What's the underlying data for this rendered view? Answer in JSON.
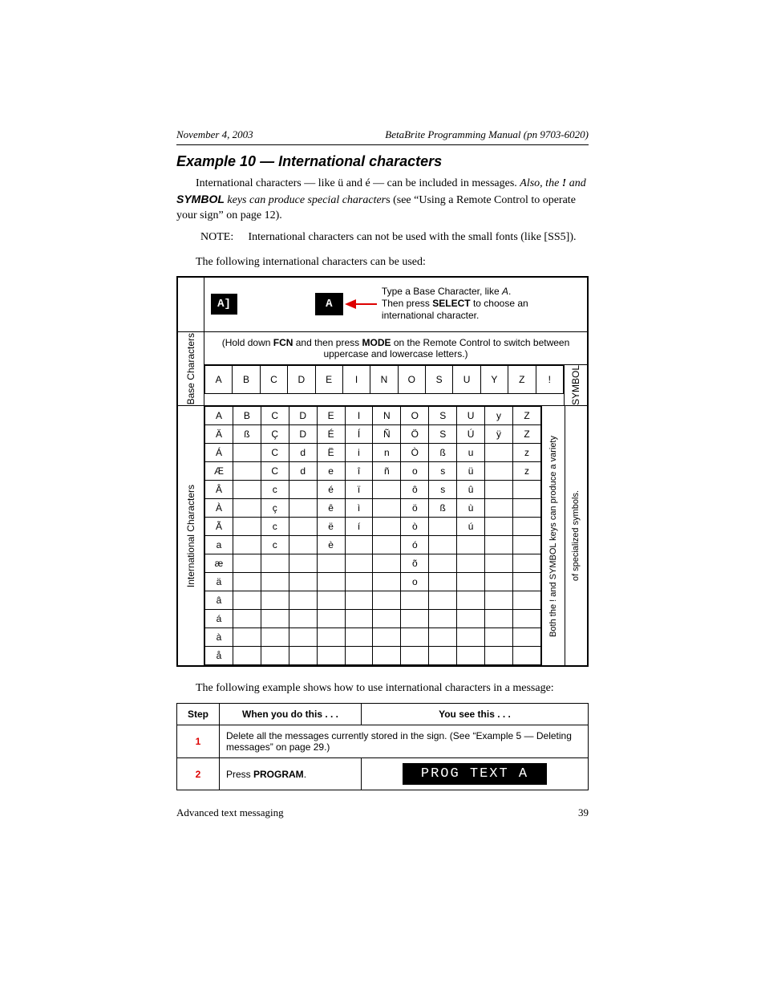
{
  "header": {
    "date": "November 4, 2003",
    "title": "BetaBrite Programming Manual (pn 9703-6020)"
  },
  "example": {
    "heading": "Example 10 — International characters",
    "intro1_a": "International characters — like ü and é — can be included in messages. ",
    "intro1_b": "Also, the ",
    "intro1_c": "! ",
    "intro1_d": "and ",
    "intro1_e": "SYMBOL",
    "intro1_f": " keys can produce special character",
    "intro1_g": "s (see “Using a Remote Control to operate your sign” on page 12).",
    "note_label": "NOTE:",
    "note_text": "International characters can not be used with the small fonts (like [SS5]).",
    "intro2": "The following international characters can be used:",
    "intro3": "The following example shows how to use international characters in a message:"
  },
  "char_block": {
    "hint_line1": "Type a Base Character, like ",
    "hint_line1_i": "A",
    "hint_line1_end": ".",
    "hint_line2_a": "Then press ",
    "hint_line2_b": "SELECT",
    "hint_line2_c": " to choose an international character.",
    "display_small": "A]",
    "display_big": "A",
    "hold_note_a": "(Hold down ",
    "hold_note_b": "FCN",
    "hold_note_c": " and then press ",
    "hold_note_d": "MODE",
    "hold_note_e": " on the Remote Control to switch between uppercase and lowercase letters.)",
    "label_base": "Base Characters",
    "label_intl": "International Characters",
    "label_symbol": "SYMBOL",
    "base_row": [
      "A",
      "B",
      "C",
      "D",
      "E",
      "I",
      "N",
      "O",
      "S",
      "U",
      "Y",
      "Z",
      "!"
    ],
    "intl_rows": [
      [
        "A",
        "B",
        "C",
        "D",
        "E",
        "I",
        "N",
        "O",
        "S",
        "U",
        "y",
        "Z"
      ],
      [
        "Ä",
        "ß",
        "Ç",
        "D",
        "É",
        "Í",
        "Ñ",
        "Ö",
        "S",
        "Ú",
        "ÿ",
        "Z"
      ],
      [
        "Á",
        "",
        "C",
        "d",
        "Ë",
        "i",
        "n",
        "Ò",
        "ß",
        "u",
        "",
        "z"
      ],
      [
        "Æ",
        "",
        "C",
        "d",
        "e",
        "î",
        "ñ",
        "o",
        "s",
        "ü",
        "",
        "z"
      ],
      [
        "Â",
        "",
        "c",
        "",
        "é",
        "ï",
        "",
        "ô",
        "s",
        "û",
        "",
        ""
      ],
      [
        "À",
        "",
        "ç",
        "",
        "ê",
        "ì",
        "",
        "ö",
        "ß",
        "ù",
        "",
        ""
      ],
      [
        "Ã",
        "",
        "c",
        "",
        "ë",
        "í",
        "",
        "ò",
        "",
        "ú",
        "",
        ""
      ],
      [
        "a",
        "",
        "c",
        "",
        "è",
        "",
        "",
        "ó",
        "",
        "",
        "",
        ""
      ],
      [
        "æ",
        "",
        "",
        "",
        "",
        "",
        "",
        "õ",
        "",
        "",
        "",
        ""
      ],
      [
        "ä",
        "",
        "",
        "",
        "",
        "",
        "",
        "o",
        "",
        "",
        "",
        ""
      ],
      [
        "â",
        "",
        "",
        "",
        "",
        "",
        "",
        "",
        "",
        "",
        "",
        ""
      ],
      [
        "á",
        "",
        "",
        "",
        "",
        "",
        "",
        "",
        "",
        "",
        "",
        ""
      ],
      [
        "à",
        "",
        "",
        "",
        "",
        "",
        "",
        "",
        "",
        "",
        "",
        ""
      ],
      [
        "å",
        "",
        "",
        "",
        "",
        "",
        "",
        "",
        "",
        "",
        "",
        ""
      ]
    ],
    "side_note_1": "Both the ! and SYMBOL keys can produce a variety",
    "side_note_2": "of specialized symbols."
  },
  "steps": {
    "head_step": "Step",
    "head_do": "When you do this . . .",
    "head_see": "You see this . . .",
    "row1_num": "1",
    "row1_text": "Delete all the messages currently stored in the sign. (See “Example 5 — Deleting messages” on page 29.)",
    "row2_num": "2",
    "row2_do_a": "Press ",
    "row2_do_b": "PROGRAM",
    "row2_do_c": ".",
    "row2_display": "PROG TEXT A"
  },
  "footer": {
    "left": "Advanced text messaging",
    "right": "39"
  }
}
